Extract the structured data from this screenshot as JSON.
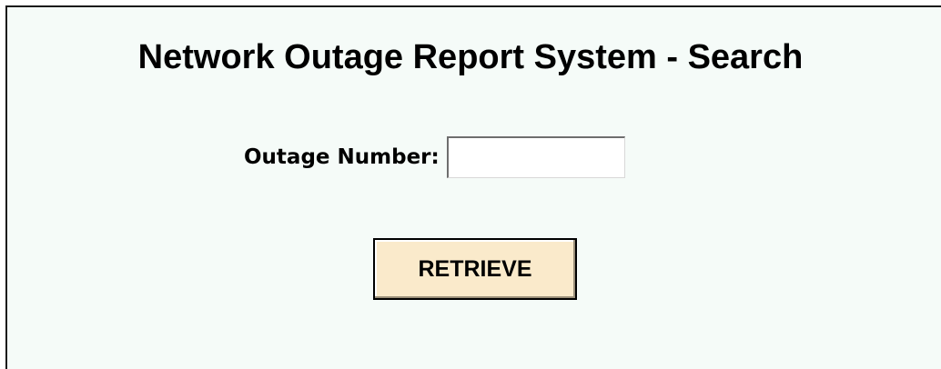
{
  "header": {
    "title": "Network Outage Report System - Search"
  },
  "search_form": {
    "outage_number_label": "Outage Number:",
    "outage_number_value": "",
    "retrieve_label": "RETRIEVE"
  },
  "colors": {
    "panel_background": "#f5fbf8",
    "button_background": "#faeacb",
    "text": "#000000"
  }
}
